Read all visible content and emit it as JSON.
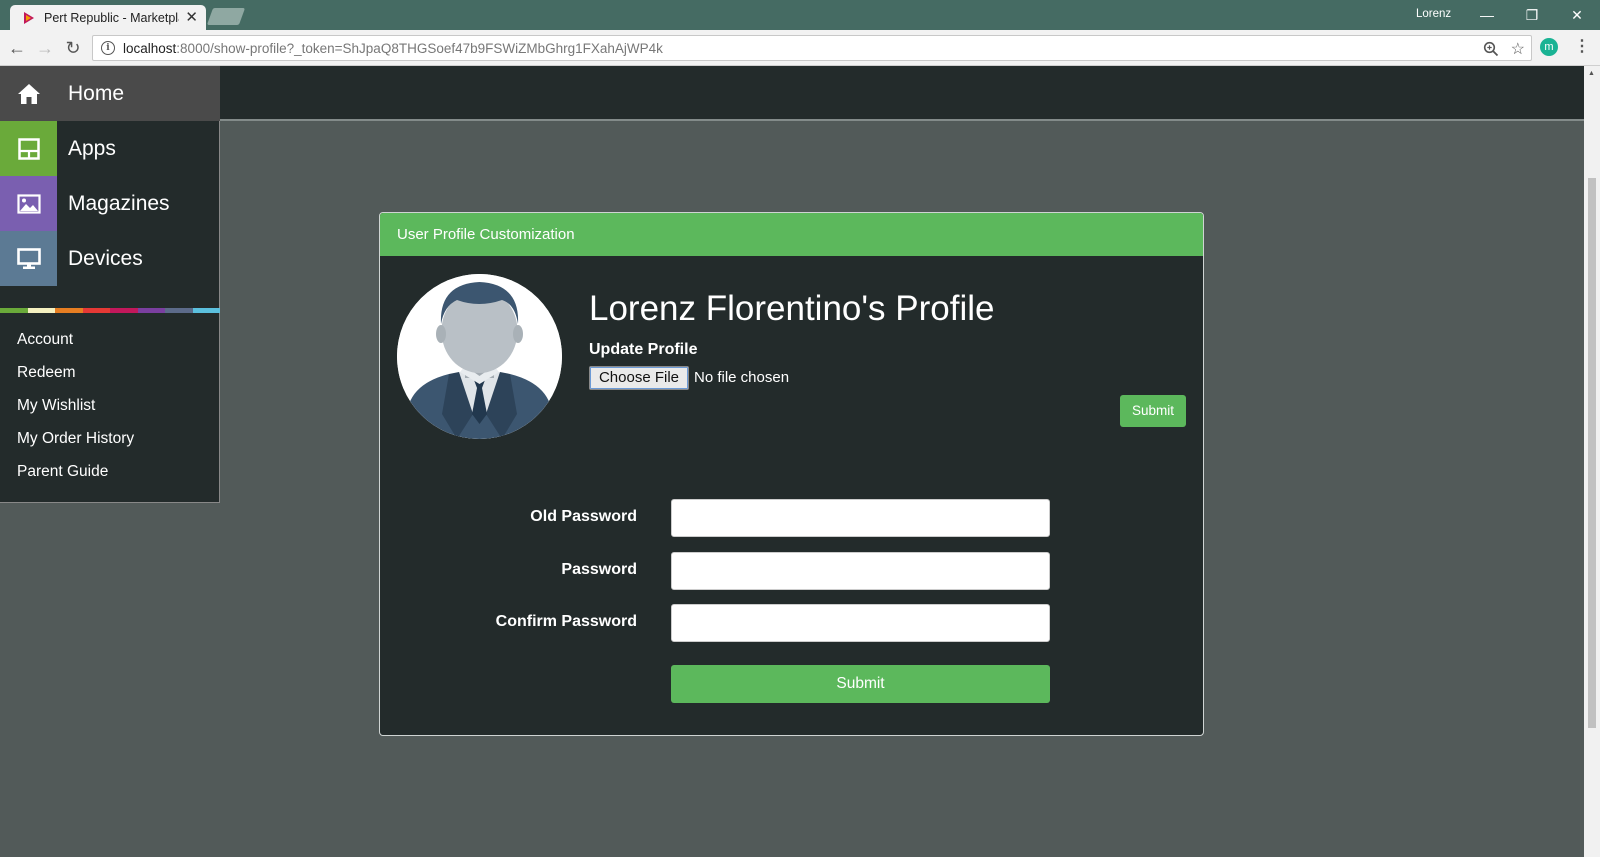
{
  "browser": {
    "tab_title": "Pert Republic - Marketplace",
    "user_name": "Lorenz",
    "url_host": "localhost",
    "url_rest": ":8000/show-profile?_token=ShJpaQ8THGSoef47b9FSWiZMbGhrg1FXahAjWP4k",
    "extension_letter": "m",
    "info_glyph": "i"
  },
  "sidebar": {
    "menu": [
      {
        "label": "Home",
        "icon": "home-icon",
        "color": "#4a4a4a"
      },
      {
        "label": "Apps",
        "icon": "apps-icon",
        "color": "#6aaa3a"
      },
      {
        "label": "Magazines",
        "icon": "image-icon",
        "color": "#7a5fb0"
      },
      {
        "label": "Devices",
        "icon": "monitor-icon",
        "color": "#5c7a94"
      }
    ],
    "stripe_colors": [
      "#6aaa3a",
      "#f4f0c0",
      "#e67e22",
      "#e53935",
      "#c2185b",
      "#7a3fa0",
      "#5c6b8a",
      "#5bc0de"
    ],
    "links": [
      "Account",
      "Redeem",
      "My Wishlist",
      "My Order History",
      "Parent Guide"
    ]
  },
  "panel": {
    "header": "User Profile Customization",
    "profile_name": "Lorenz Florentino's Profile",
    "update_label": "Update Profile",
    "file_button": "Choose File",
    "file_status": "No file chosen",
    "submit_small": "Submit",
    "fields": [
      {
        "label": "Old Password",
        "value": ""
      },
      {
        "label": "Password",
        "value": ""
      },
      {
        "label": "Confirm Password",
        "value": ""
      }
    ],
    "submit_big": "Submit"
  },
  "colors": {
    "accent_green": "#5cb85c",
    "panel_bg": "#232b2b",
    "page_bg": "#525a59"
  }
}
